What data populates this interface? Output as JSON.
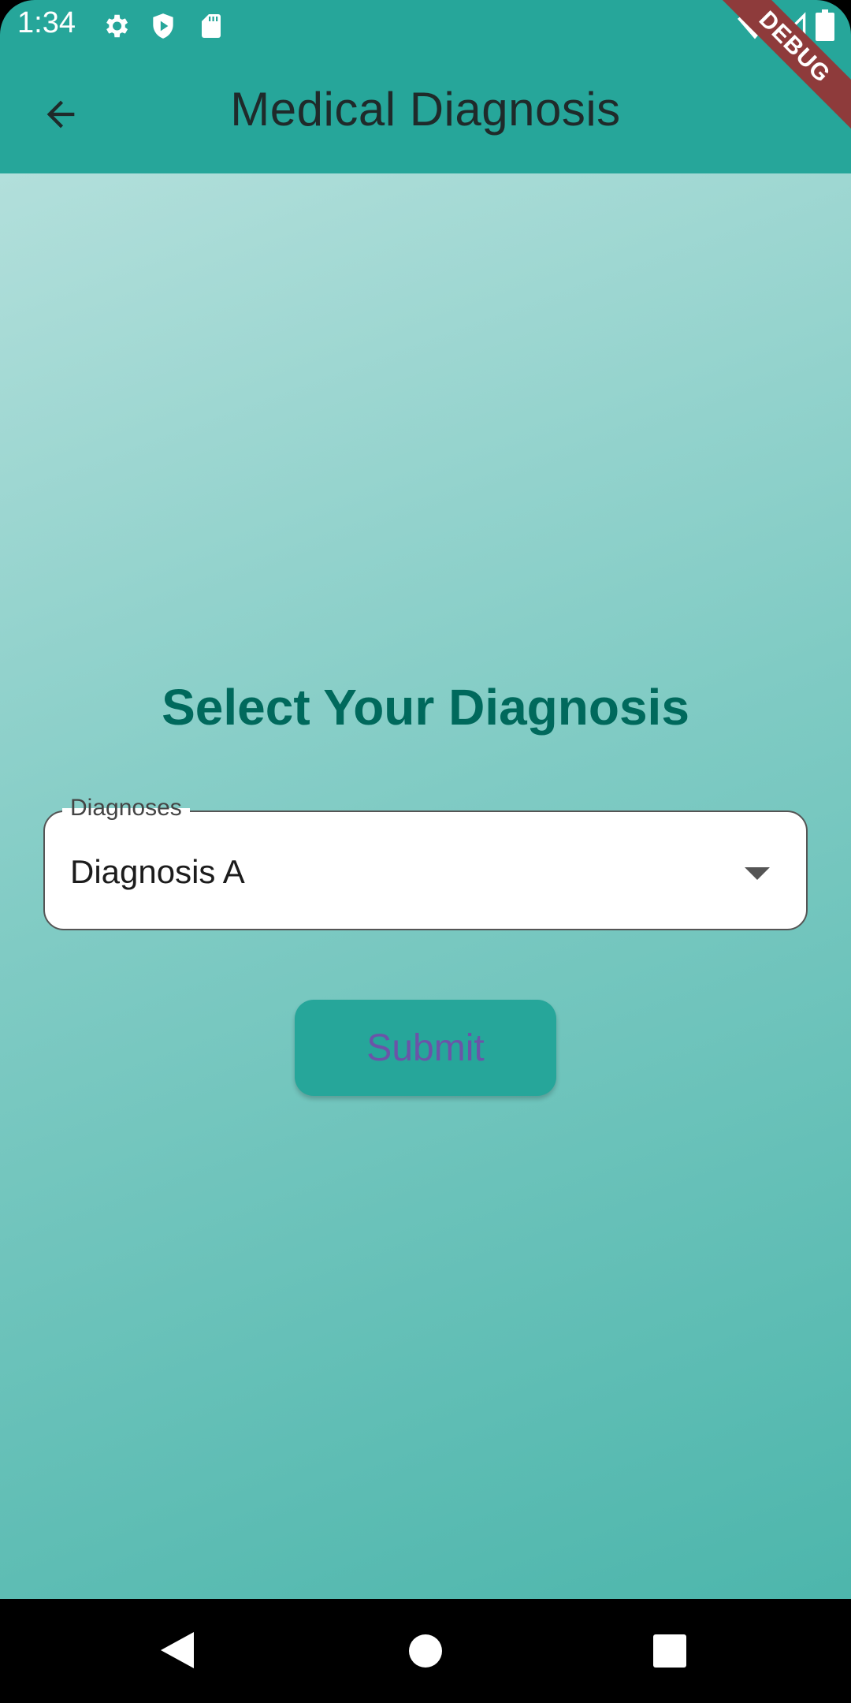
{
  "status_bar": {
    "time": "1:34",
    "icons": [
      "settings-icon",
      "shield-play-icon",
      "sd-card-icon",
      "wifi-icon",
      "signal-icon",
      "battery-icon"
    ]
  },
  "app_bar": {
    "title": "Medical Diagnosis",
    "back_icon": "arrow-back-icon",
    "debug_label": "DEBUG"
  },
  "main": {
    "heading": "Select Your Diagnosis",
    "dropdown": {
      "label": "Diagnoses",
      "selected": "Diagnosis A"
    },
    "submit_label": "Submit"
  },
  "nav_bar": {
    "icons": [
      "back-triangle-icon",
      "home-circle-icon",
      "recents-square-icon"
    ]
  },
  "colors": {
    "primary": "#26a69a",
    "heading": "#00695c",
    "button_text": "#6b54a8"
  }
}
